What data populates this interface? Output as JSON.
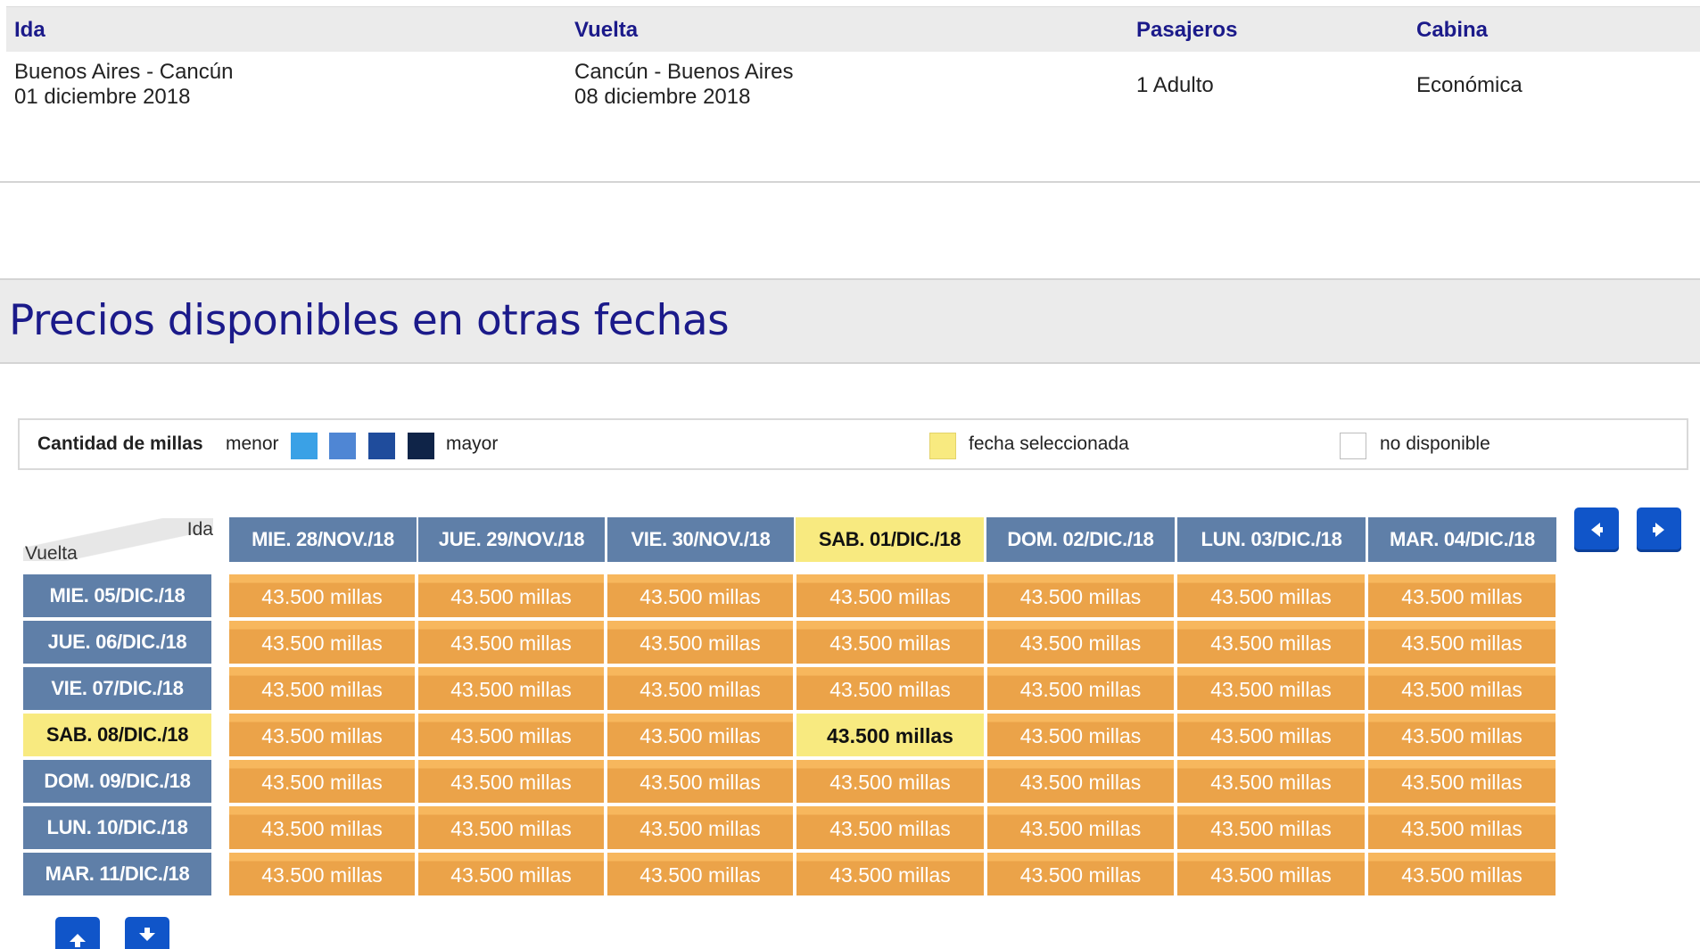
{
  "summary": {
    "headers": {
      "ida": "Ida",
      "vuelta": "Vuelta",
      "pasajeros": "Pasajeros",
      "cabina": "Cabina"
    },
    "ida_route": "Buenos Aires - Cancún",
    "ida_date": "01 diciembre 2018",
    "vuelta_route": "Cancún - Buenos Aires",
    "vuelta_date": "08 diciembre 2018",
    "pasajeros": "1 Adulto",
    "cabina": "Económica"
  },
  "section_title": "Precios disponibles en otras fechas",
  "legend": {
    "label": "Cantidad de millas",
    "menor": "menor",
    "mayor": "mayor",
    "scale_colors": [
      "#3aa1e6",
      "#4f86d4",
      "#1f4c9c",
      "#0f2448"
    ],
    "selected_color": "#f8ea80",
    "selected_label": "fecha seleccionada",
    "unavailable_label": "no disponible"
  },
  "grid": {
    "corner_ida": "Ida",
    "corner_vuelta": "Vuelta",
    "columns": [
      "MIE. 28/NOV./18",
      "JUE. 29/NOV./18",
      "VIE. 30/NOV./18",
      "SAB. 01/DIC./18",
      "DOM. 02/DIC./18",
      "LUN. 03/DIC./18",
      "MAR. 04/DIC./18"
    ],
    "rows": [
      "MIE. 05/DIC./18",
      "JUE. 06/DIC./18",
      "VIE. 07/DIC./18",
      "SAB. 08/DIC./18",
      "DOM. 09/DIC./18",
      "LUN. 10/DIC./18",
      "MAR. 11/DIC./18"
    ],
    "selected_column": 3,
    "selected_row": 3,
    "cells": [
      [
        "43.500 millas",
        "43.500 millas",
        "43.500 millas",
        "43.500 millas",
        "43.500 millas",
        "43.500 millas",
        "43.500 millas"
      ],
      [
        "43.500 millas",
        "43.500 millas",
        "43.500 millas",
        "43.500 millas",
        "43.500 millas",
        "43.500 millas",
        "43.500 millas"
      ],
      [
        "43.500 millas",
        "43.500 millas",
        "43.500 millas",
        "43.500 millas",
        "43.500 millas",
        "43.500 millas",
        "43.500 millas"
      ],
      [
        "43.500 millas",
        "43.500 millas",
        "43.500 millas",
        "43.500 millas",
        "43.500 millas",
        "43.500 millas",
        "43.500 millas"
      ],
      [
        "43.500 millas",
        "43.500 millas",
        "43.500 millas",
        "43.500 millas",
        "43.500 millas",
        "43.500 millas",
        "43.500 millas"
      ],
      [
        "43.500 millas",
        "43.500 millas",
        "43.500 millas",
        "43.500 millas",
        "43.500 millas",
        "43.500 millas",
        "43.500 millas"
      ],
      [
        "43.500 millas",
        "43.500 millas",
        "43.500 millas",
        "43.500 millas",
        "43.500 millas",
        "43.500 millas",
        "43.500 millas"
      ]
    ]
  },
  "nav": {
    "prev_icon": "arrow-left-icon",
    "next_icon": "arrow-right-icon",
    "up_icon": "arrow-up-icon",
    "down_icon": "arrow-down-icon"
  }
}
